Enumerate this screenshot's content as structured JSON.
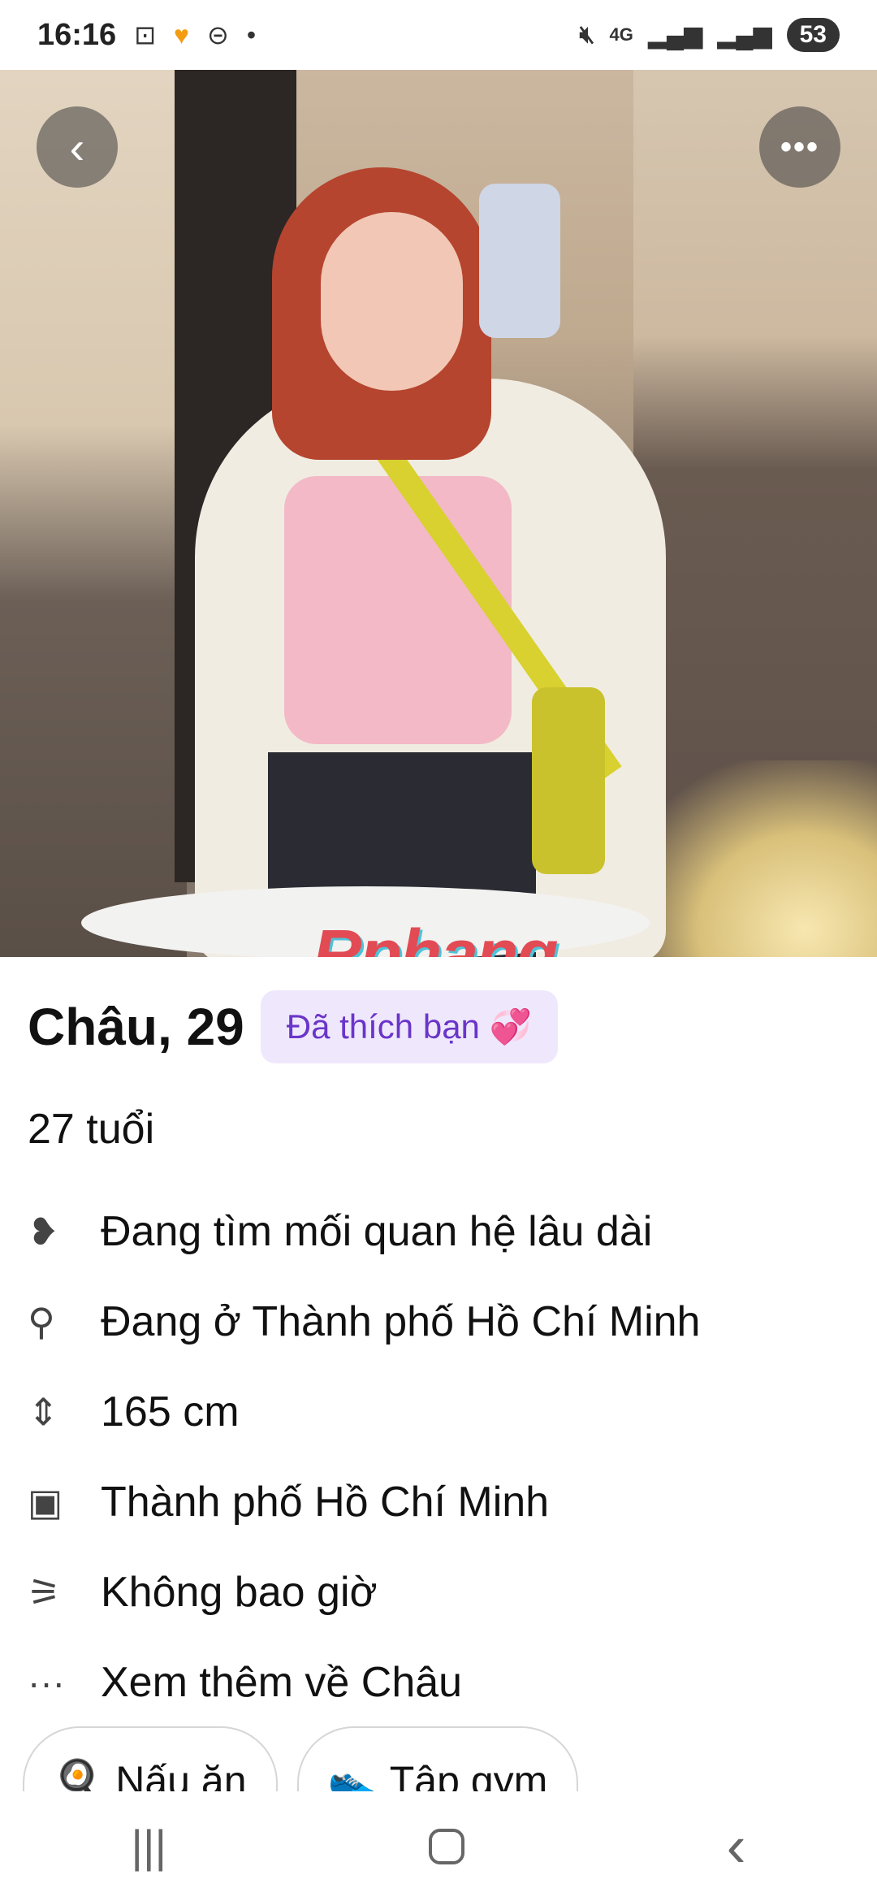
{
  "status_bar": {
    "time": "16:16",
    "left_icons": [
      "screen-record-icon",
      "app-notification-icon",
      "voicemail-icon",
      "dot-icon"
    ],
    "network": "4G",
    "battery": "53"
  },
  "header": {
    "back_label": "‹",
    "more_label": "•••"
  },
  "photo": {
    "watermark": "Rphang"
  },
  "profile": {
    "name_age": "Châu, 29",
    "liked_badge": "Đã thích bạn",
    "liked_emoji": "💞",
    "age_text": "27 tuổi",
    "details": [
      {
        "icon": "hearts-icon",
        "glyph": "❥",
        "text": "Đang tìm mối quan hệ lâu dài"
      },
      {
        "icon": "location-pin-icon",
        "glyph": "⚲",
        "text": "Đang ở Thành phố Hồ Chí Minh"
      },
      {
        "icon": "height-icon",
        "glyph": "⇕",
        "text": "165 cm"
      },
      {
        "icon": "briefcase-icon",
        "glyph": "▣",
        "text": "Thành phố Hồ Chí Minh"
      },
      {
        "icon": "smoking-icon",
        "glyph": "⚞",
        "text": "Không bao giờ"
      },
      {
        "icon": "more-dots-icon",
        "glyph": "···",
        "text": "Xem thêm về Châu"
      }
    ],
    "interests": [
      {
        "icon": "frying-pan-icon",
        "glyph": "🍳",
        "label": "Nấu ăn"
      },
      {
        "icon": "sneaker-icon",
        "glyph": "👟",
        "label": "Tập gym"
      }
    ]
  },
  "nav_bar": {
    "recent_label": "|||",
    "back_label": "‹"
  }
}
